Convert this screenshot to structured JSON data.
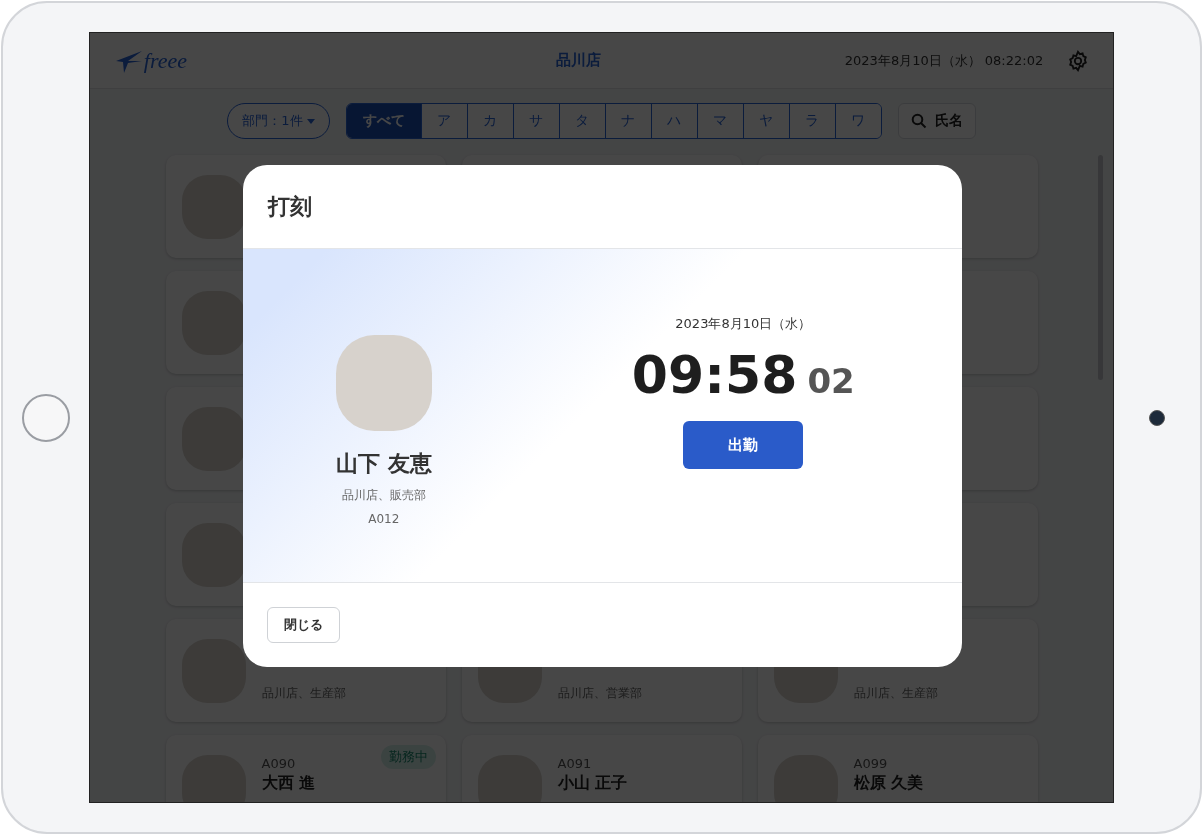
{
  "header": {
    "logo": "freee",
    "store": "品川店",
    "datetime": "2023年8月10日（水） 08:22:02"
  },
  "filters": {
    "department": "部門：1件",
    "kana_tabs": [
      {
        "label": "すべて",
        "selected": true
      },
      {
        "label": "ア",
        "selected": false
      },
      {
        "label": "カ",
        "selected": false
      },
      {
        "label": "サ",
        "selected": false
      },
      {
        "label": "タ",
        "selected": false
      },
      {
        "label": "ナ",
        "selected": false
      },
      {
        "label": "ハ",
        "selected": false
      },
      {
        "label": "マ",
        "selected": false
      },
      {
        "label": "ヤ",
        "selected": false
      },
      {
        "label": "ラ",
        "selected": false
      },
      {
        "label": "ワ",
        "selected": false
      }
    ],
    "search": "氏名"
  },
  "employees": [
    {
      "department": "品川店、生産部"
    },
    {
      "department": "品川店、営業部"
    },
    {
      "department": "品川店、生産部"
    },
    {
      "code": "A090",
      "name": "大西 進",
      "badge": "勤務中"
    },
    {
      "code": "A091",
      "name": "小山 正子"
    },
    {
      "code": "A099",
      "name": "松原 久美"
    }
  ],
  "dialog": {
    "title": "打刻",
    "employee": {
      "name": "山下 友恵",
      "department": "品川店、販売部",
      "code": "A012"
    },
    "date": "2023年8月10日（水）",
    "time": "09:58",
    "seconds": "02",
    "action": "出勤",
    "close": "閉じる"
  }
}
